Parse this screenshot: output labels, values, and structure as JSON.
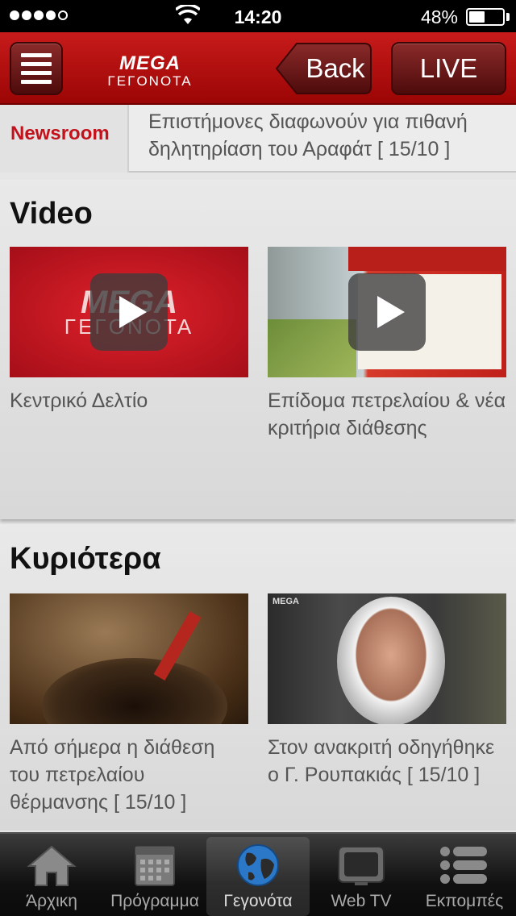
{
  "status_bar": {
    "time": "14:20",
    "battery_percent": "48%",
    "battery_level": 0.48,
    "signal_bars": 4
  },
  "nav": {
    "logo_line1": "MEGA",
    "logo_line2": "ΓΕΓΟΝΟΤΑ",
    "back_label": "Back",
    "live_label": "LIVE",
    "accent_color": "#b30f12"
  },
  "ticker": {
    "label": "Newsroom",
    "text": "Επιστήμονες διαφωνούν για πιθανή δηλητηρίαση του Αραφάτ [ 15/10 ]"
  },
  "video_section": {
    "title": "Video",
    "items": [
      {
        "title": "Κεντρικό Δελτίο",
        "thumb": "mega-logo-red"
      },
      {
        "title": "Επίδομα πετρελαίου & νέα κριτήρια διάθεσης",
        "thumb": "heating-oil-graphic"
      }
    ]
  },
  "main_section": {
    "title": "Κυριότερα",
    "items": [
      {
        "title": "Από σήμερα η διάθεση του πετρελαίου θέρμανσης [ 15/10 ]",
        "thumb": "oil-tank-photo"
      },
      {
        "title": "Στον ανακριτή οδηγήθηκε ο Γ. Ρουπακιάς [ 15/10 ]",
        "thumb": "suspect-photo"
      }
    ]
  },
  "tab_bar": {
    "tabs": [
      {
        "label": "Άρχικη",
        "icon": "home-icon"
      },
      {
        "label": "Πρόγραμμα",
        "icon": "calendar-icon"
      },
      {
        "label": "Γεγονότα",
        "icon": "globe-icon",
        "active": true
      },
      {
        "label": "Web TV",
        "icon": "tv-icon"
      },
      {
        "label": "Εκπομπές",
        "icon": "list-icon"
      }
    ]
  }
}
